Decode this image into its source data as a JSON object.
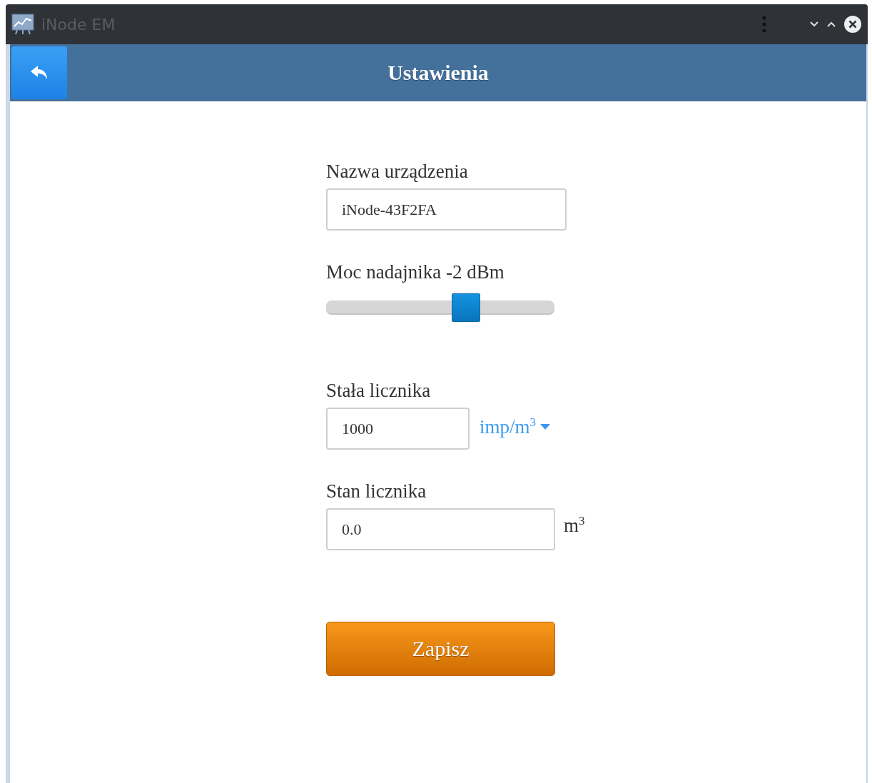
{
  "window": {
    "title": "iNode EM",
    "active": false
  },
  "header": {
    "title": "Ustawienia"
  },
  "form": {
    "device_name": {
      "label": "Nazwa urządzenia",
      "value": "iNode-43F2FA"
    },
    "tx_power": {
      "label": "Moc nadajnika -2 dBm",
      "level": 0.63
    },
    "meter_constant": {
      "label": "Stała licznika",
      "value": "1000",
      "unit": "imp/m$^{3}$"
    },
    "meter_state": {
      "label": "Stan licznika",
      "value": "0.0",
      "unit": "m$^{3}$"
    },
    "save_button": "Zapisz"
  }
}
